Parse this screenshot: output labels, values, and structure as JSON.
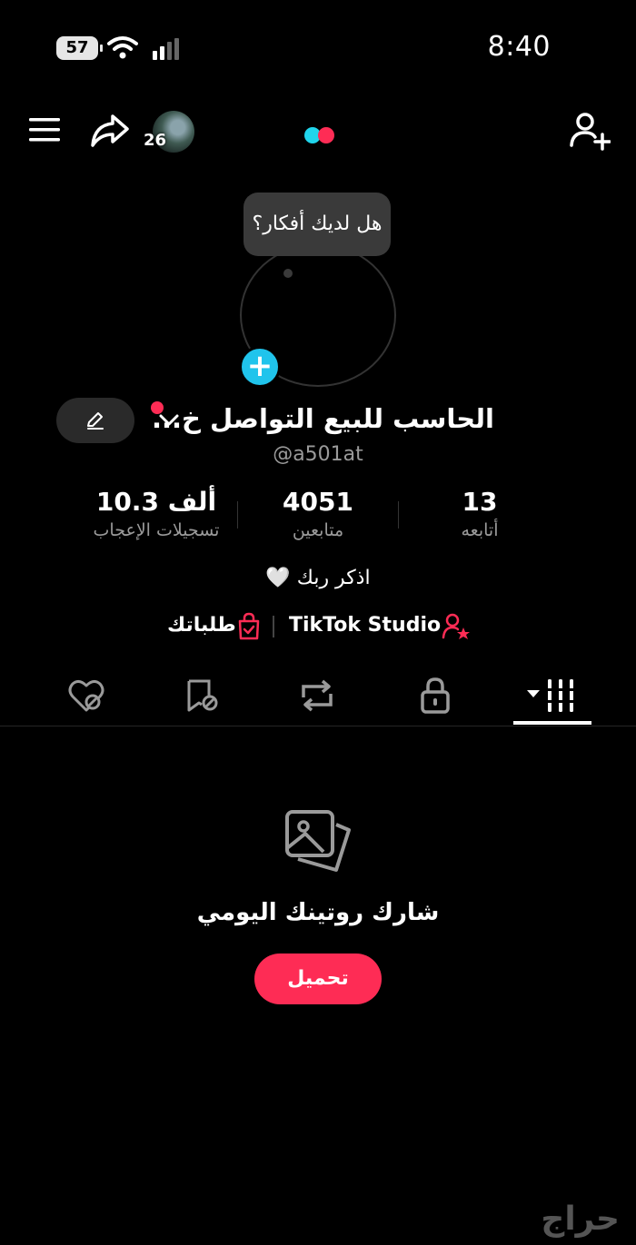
{
  "status_bar": {
    "battery": "57",
    "time": "8:40"
  },
  "topnav": {
    "story_count": "26"
  },
  "profile": {
    "tooltip": "هل لديك أفكار؟",
    "display_name": "الحاسب للبيع التواصل خ...",
    "username": "@a501at",
    "bio": "اذكر ربك 🤍"
  },
  "stats": {
    "following": {
      "value": "13",
      "label": "أتابعه"
    },
    "followers": {
      "value": "4051",
      "label": "متابعين"
    },
    "likes": {
      "value": "10.3 ألف",
      "label": "تسجيلات الإعجاب"
    }
  },
  "links": {
    "studio": "TikTok Studio",
    "orders": "طلباتك"
  },
  "tabs": [
    "videos",
    "private",
    "reposts",
    "saved",
    "liked"
  ],
  "empty_state": {
    "title": "شارك روتينك اليومي",
    "button": "تحميل"
  },
  "watermark": "حراج",
  "colors": {
    "accent": "#fe2c55",
    "plus_badge": "#20c4ec",
    "background": "#000000"
  }
}
